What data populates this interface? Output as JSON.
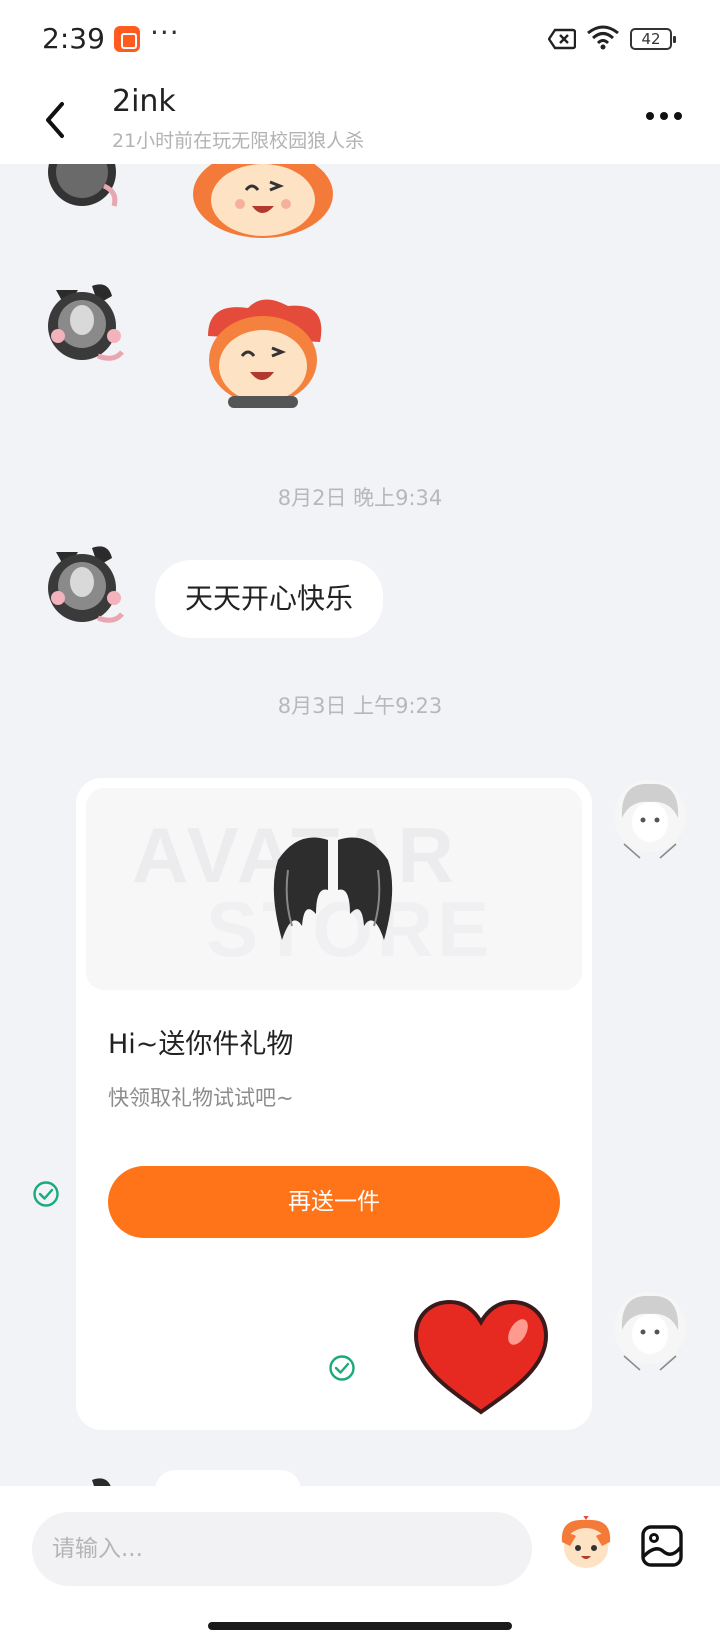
{
  "status_bar": {
    "time": "2:39",
    "more": "···",
    "battery": "42"
  },
  "header": {
    "name": "2ink",
    "status": "21小时前在玩无限校园狼人杀"
  },
  "chat": {
    "timestamp_1": "8月2日 晚上9:34",
    "message_1": "天天开心快乐",
    "timestamp_2": "8月3日 上午9:23",
    "gift_card": {
      "watermark_1": "AVATAR",
      "watermark_2": "STORE",
      "title": "Hi~送你件礼物",
      "subtitle": "快领取礼物试试吧~",
      "button": "再送一件"
    }
  },
  "input": {
    "placeholder": "请输入..."
  },
  "colors": {
    "accent": "#ff7418",
    "check": "#1aab7a",
    "background": "#f2f3f7"
  }
}
